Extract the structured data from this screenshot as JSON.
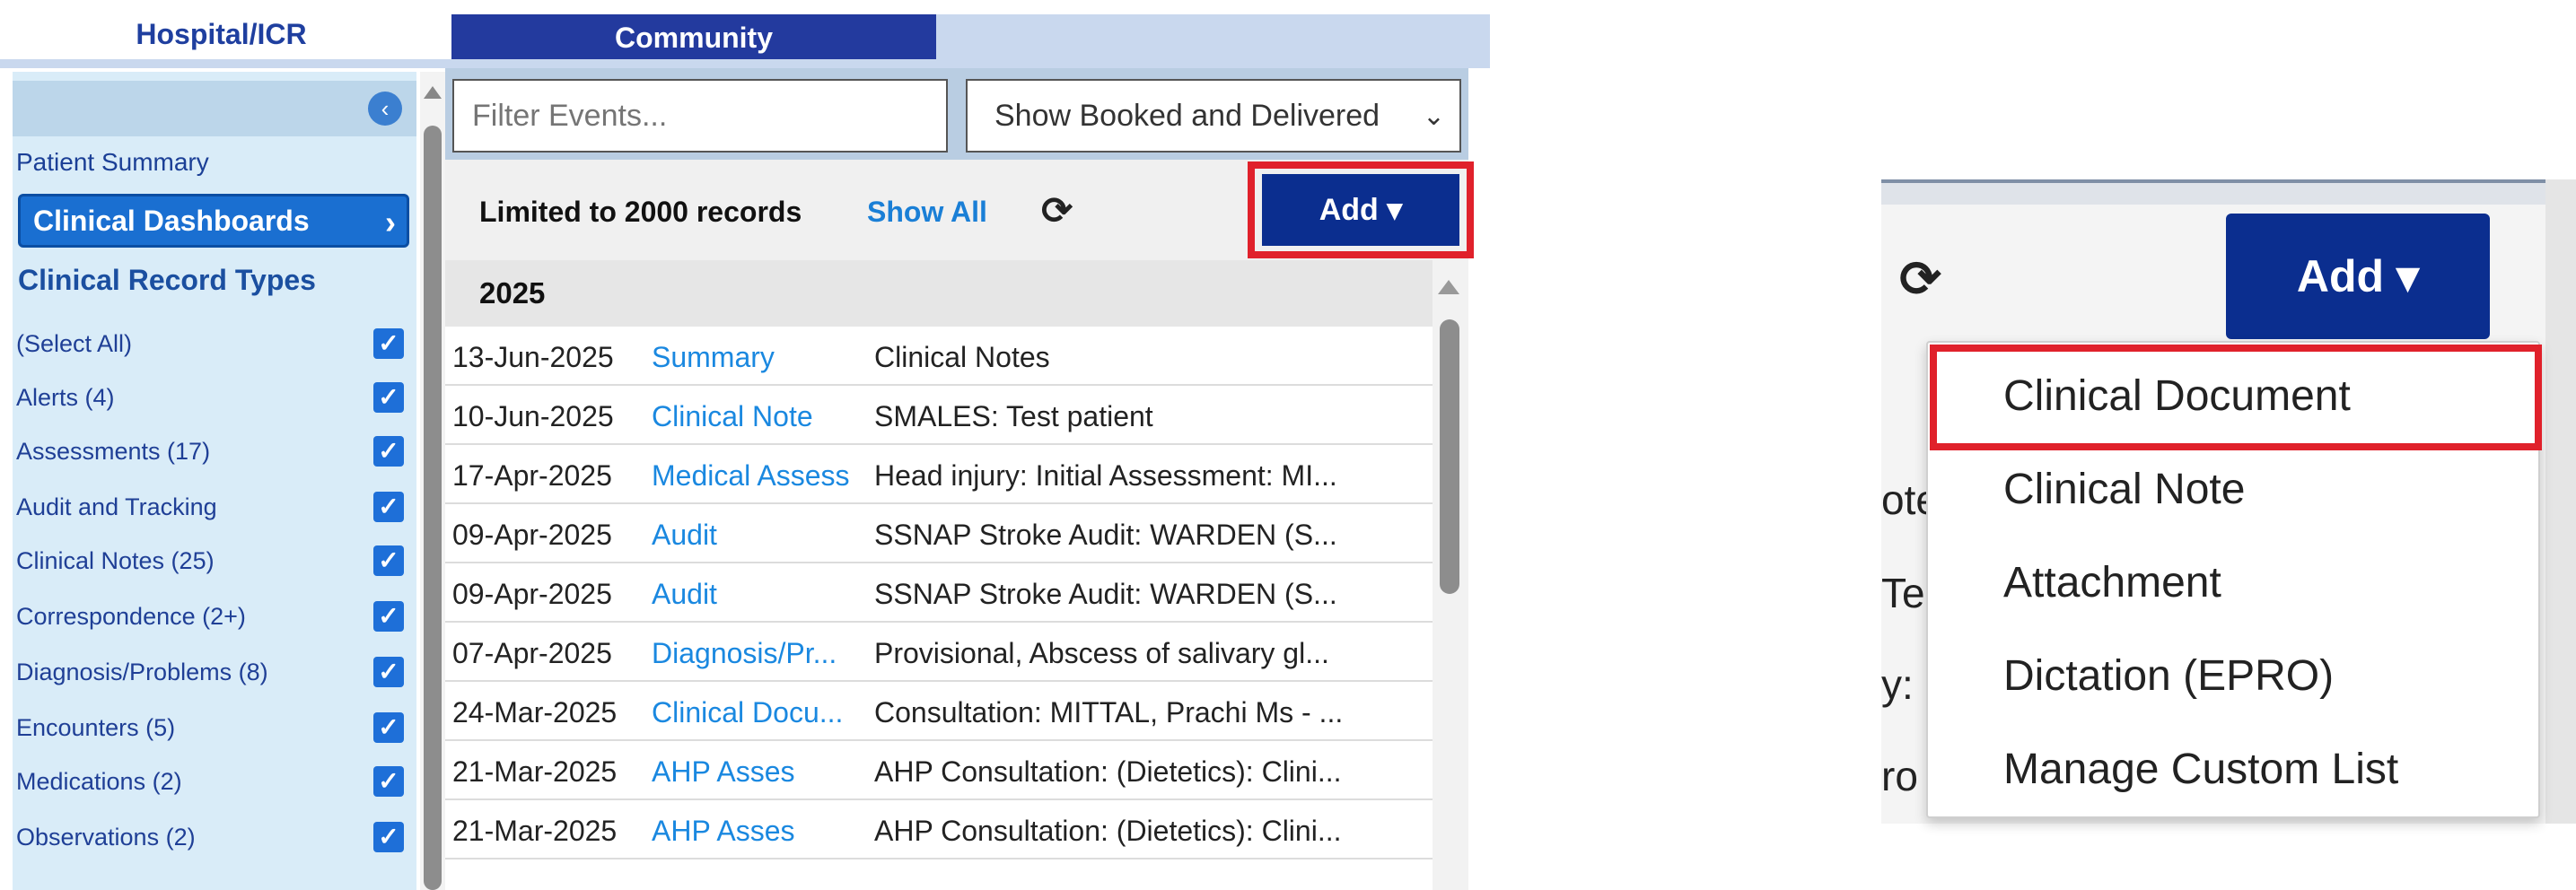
{
  "tabs": {
    "hospital": "Hospital/ICR",
    "community": "Community"
  },
  "sidebar": {
    "patient_summary": "Patient Summary",
    "clinical_dashboards": "Clinical Dashboards",
    "section_heading": "Clinical Record Types",
    "record_types": [
      {
        "label": "(Select All)",
        "checked": true
      },
      {
        "label": "Alerts (4)",
        "checked": true
      },
      {
        "label": "Assessments (17)",
        "checked": true
      },
      {
        "label": "Audit and Tracking",
        "checked": true
      },
      {
        "label": "Clinical Notes (25)",
        "checked": true
      },
      {
        "label": "Correspondence (2+)",
        "checked": true
      },
      {
        "label": "Diagnosis/Problems (8)",
        "checked": true
      },
      {
        "label": "Encounters (5)",
        "checked": true
      },
      {
        "label": "Medications (2)",
        "checked": true
      },
      {
        "label": "Observations (2)",
        "checked": true
      }
    ]
  },
  "filters": {
    "search_placeholder": "Filter Events...",
    "show_select_value": "Show Booked and Delivered"
  },
  "toolbar": {
    "limit_text": "Limited to 2000 records",
    "show_all": "Show All",
    "add_label": "Add ▾"
  },
  "events": {
    "year": "2025",
    "rows": [
      {
        "date": "13-Jun-2025",
        "type": "Summary",
        "summary": "Clinical Notes"
      },
      {
        "date": "10-Jun-2025",
        "type": "Clinical Note",
        "summary": "SMALES: Test patient"
      },
      {
        "date": "17-Apr-2025",
        "type": "Medical Assess",
        "summary": "Head injury: Initial Assessment: MI..."
      },
      {
        "date": "09-Apr-2025",
        "type": "Audit",
        "summary": "SSNAP Stroke Audit: WARDEN (S..."
      },
      {
        "date": "09-Apr-2025",
        "type": "Audit",
        "summary": "SSNAP Stroke Audit: WARDEN (S..."
      },
      {
        "date": "07-Apr-2025",
        "type": "Diagnosis/Pr...",
        "summary": "Provisional, Abscess of salivary gl..."
      },
      {
        "date": "24-Mar-2025",
        "type": "Clinical Docu...",
        "summary": "Consultation: MITTAL, Prachi Ms - ..."
      },
      {
        "date": "21-Mar-2025",
        "type": "AHP Asses",
        "summary": "AHP Consultation: (Dietetics): Clini..."
      },
      {
        "date": "21-Mar-2025",
        "type": "AHP Asses",
        "summary": "AHP Consultation: (Dietetics): Clini..."
      }
    ]
  },
  "zoom": {
    "add_label": "Add ▾",
    "fragments": [
      "ote",
      "Te",
      "y:",
      "ro"
    ],
    "menu_items": [
      "Clinical Document",
      "Clinical Note",
      "Attachment",
      "Dictation (EPRO)",
      "Manage Custom List"
    ],
    "highlighted_item": "Clinical Document"
  },
  "colors": {
    "nav_blue": "#233a9e",
    "button_navy": "#0b2e8f",
    "link_blue": "#1a88e0",
    "highlight_red": "#e0212b",
    "checkbox_blue": "#1e6fd8"
  },
  "icons": {
    "collapse": "chevron-left-icon",
    "refresh": "refresh-icon",
    "checkbox": "checkmark-icon"
  }
}
